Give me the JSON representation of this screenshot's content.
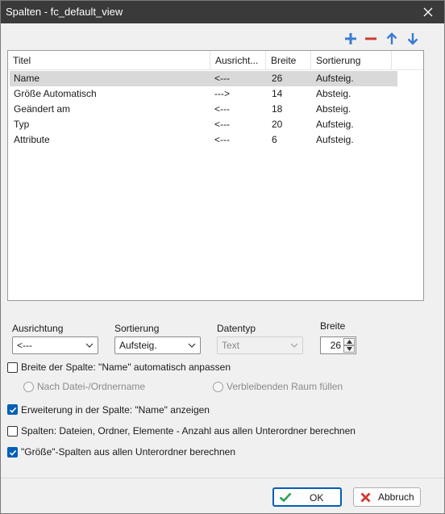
{
  "window": {
    "title": "Spalten - fc_default_view"
  },
  "toolbar": {
    "icons": [
      "plus-icon",
      "minus-icon",
      "arrow-up-icon",
      "arrow-down-icon"
    ],
    "accent": "#3a7bd5",
    "remove_color": "#d03b2f"
  },
  "columns_list": {
    "headers": [
      "Titel",
      "Ausricht...",
      "Breite",
      "Sortierung"
    ],
    "rows": [
      {
        "title": "Name",
        "align": "<---",
        "width": "26",
        "sort": "Aufsteig.",
        "selected": true
      },
      {
        "title": "Größe Automatisch",
        "align": "--->",
        "width": "14",
        "sort": "Absteig.",
        "selected": false
      },
      {
        "title": "Geändert am",
        "align": "<---",
        "width": "18",
        "sort": "Absteig.",
        "selected": false
      },
      {
        "title": "Typ",
        "align": "<---",
        "width": "20",
        "sort": "Aufsteig.",
        "selected": false
      },
      {
        "title": "Attribute",
        "align": "<---",
        "width": "6",
        "sort": "Aufsteig.",
        "selected": false
      }
    ]
  },
  "settings": {
    "alignment_label": "Ausrichtung",
    "alignment_value": "<---",
    "sorting_label": "Sortierung",
    "sorting_value": "Aufsteig.",
    "datatype_label": "Datentyp",
    "datatype_value": "Text",
    "width_label": "Breite",
    "width_value": "26"
  },
  "options": {
    "auto_width_label": "Breite der Spalte: \"Name\" automatisch anpassen",
    "auto_width_checked": false,
    "radio_name_label": "Nach Datei-/Ordnername",
    "radio_fill_label": "Verbleibenden Raum füllen",
    "extension_label": "Erweiterung in der Spalte: \"Name\" anzeigen",
    "extension_checked": true,
    "count_label": "Spalten: Dateien, Ordner, Elemente - Anzahl aus allen Unterordner berechnen",
    "count_checked": false,
    "size_label": "\"Größe\"-Spalten aus allen Unterordner berechnen",
    "size_checked": true
  },
  "buttons": {
    "ok_label": "OK",
    "cancel_label": "Abbruch",
    "ok_color": "#2e9e5b",
    "cancel_color": "#d03b2f"
  }
}
